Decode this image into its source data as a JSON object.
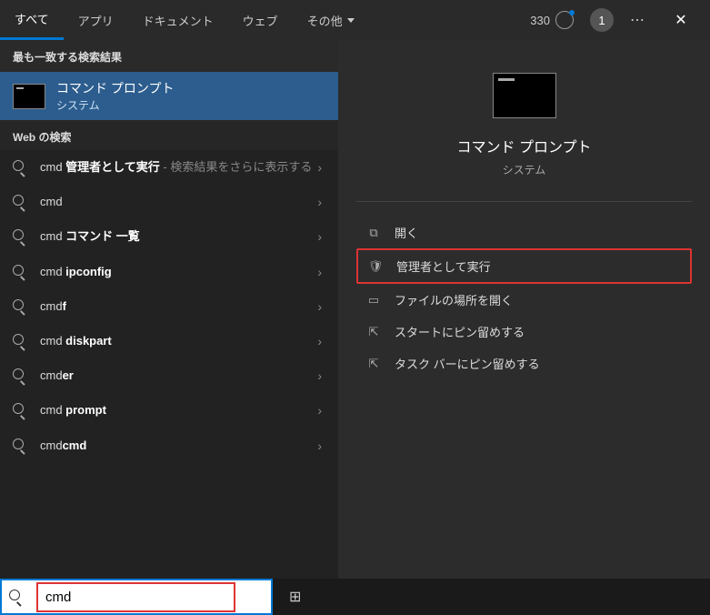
{
  "header": {
    "tabs": {
      "all": "すべて",
      "apps": "アプリ",
      "documents": "ドキュメント",
      "web": "ウェブ",
      "more": "その他"
    },
    "points": "330",
    "user_badge": "1"
  },
  "left": {
    "best_match_header": "最も一致する検索結果",
    "best_match": {
      "title": "コマンド プロンプト",
      "subtitle": "システム"
    },
    "web_header": "Web の検索",
    "results": [
      {
        "prefix": "cmd ",
        "bold": "管理者として実行",
        "suffix": " - 検索結果をさらに表示する"
      },
      {
        "prefix": "cmd",
        "bold": "",
        "suffix": ""
      },
      {
        "prefix": "cmd ",
        "bold": "コマンド 一覧",
        "suffix": ""
      },
      {
        "prefix": "cmd ",
        "bold": "ipconfig",
        "suffix": ""
      },
      {
        "prefix": "cmd",
        "bold": "f",
        "suffix": ""
      },
      {
        "prefix": "cmd ",
        "bold": "diskpart",
        "suffix": ""
      },
      {
        "prefix": "cmd",
        "bold": "er",
        "suffix": ""
      },
      {
        "prefix": "cmd ",
        "bold": "prompt",
        "suffix": ""
      },
      {
        "prefix": "cmd",
        "bold": "cmd",
        "suffix": ""
      }
    ]
  },
  "right": {
    "app_title": "コマンド プロンプト",
    "app_subtitle": "システム",
    "actions": {
      "open": "開く",
      "run_admin": "管理者として実行",
      "open_location": "ファイルの場所を開く",
      "pin_start": "スタートにピン留めする",
      "pin_taskbar": "タスク バーにピン留めする"
    }
  },
  "search": {
    "value": "cmd"
  }
}
